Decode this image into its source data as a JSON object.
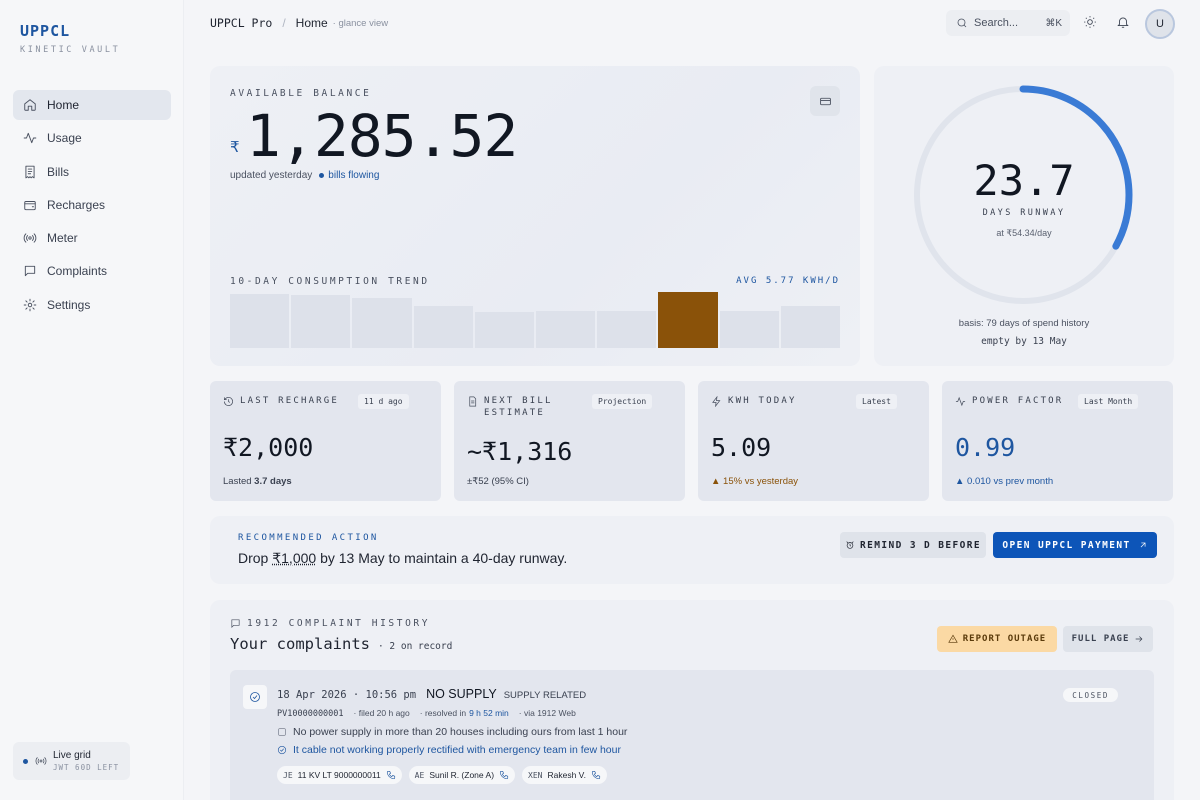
{
  "brand": {
    "name": "UPPCL",
    "tagline": "KINETIC VAULT"
  },
  "sidebar": {
    "items": [
      {
        "label": "Home",
        "icon": "home-icon",
        "active": true
      },
      {
        "label": "Usage",
        "icon": "activity-icon"
      },
      {
        "label": "Bills",
        "icon": "receipt-icon"
      },
      {
        "label": "Recharges",
        "icon": "wallet-icon"
      },
      {
        "label": "Meter",
        "icon": "meter-icon"
      },
      {
        "label": "Complaints",
        "icon": "message-icon"
      },
      {
        "label": "Settings",
        "icon": "gear-icon"
      }
    ],
    "live": {
      "title": "Live grid",
      "sub": "JWT 60D LEFT"
    }
  },
  "header": {
    "app": "UPPCL Pro",
    "page": "Home",
    "hint": "· glance view",
    "search_placeholder": "Search...",
    "shortcut": "⌘K",
    "avatar": "U"
  },
  "balance": {
    "label": "AVAILABLE BALANCE",
    "currency": "₹",
    "value": "1,285.52",
    "updated": "updated yesterday",
    "status": "bills flowing",
    "trend_label": "10-DAY CONSUMPTION TREND",
    "trend_avg": "AVG 5.77 KWH/D"
  },
  "chart_data": {
    "type": "bar",
    "title": "10-DAY CONSUMPTION TREND",
    "values": [
      5.4,
      5.3,
      5.0,
      4.2,
      3.6,
      3.7,
      3.7,
      5.6,
      3.7,
      4.2
    ],
    "highlight_index": 7,
    "unit": "kWh/d",
    "average": 5.77,
    "colors": {
      "bar": "#dde1ea",
      "highlight": "#8a5209"
    }
  },
  "runway": {
    "value": "23.7",
    "label": "DAYS RUNWAY",
    "rate": "at ₹54.34/day",
    "basis": "basis: 79 days of spend history",
    "empty": "empty by 13 May",
    "progress": 0.33,
    "accent": "#3a7bd5"
  },
  "stats": [
    {
      "title": "LAST RECHARGE",
      "icon": "history-icon",
      "badge": "11 d ago",
      "value": "₹2,000",
      "foot_pre": "Lasted ",
      "foot_bold": "3.7 days",
      "foot_post": ""
    },
    {
      "title": "NEXT BILL ESTIMATE",
      "icon": "document-icon",
      "badge": "Projection",
      "value": "~₹1,316",
      "foot_pre": "±₹52 (95% CI)",
      "foot_bold": "",
      "foot_post": ""
    },
    {
      "title": "KWH TODAY",
      "icon": "bolt-icon",
      "badge": "Latest",
      "value": "5.09",
      "foot_pre": "▲ 15% vs yesterday",
      "foot_bold": "",
      "foot_post": ""
    },
    {
      "title": "POWER FACTOR",
      "icon": "pulse-icon",
      "badge": "Last Month",
      "value": "0.99",
      "foot_pre": "▲ 0.010 vs prev month",
      "foot_bold": "",
      "foot_post": ""
    }
  ],
  "recommendation": {
    "label": "RECOMMENDED ACTION",
    "text_pre": "Drop ",
    "amount": "₹1,000",
    "text_post": " by 13 May to maintain a 40-day runway.",
    "remind_label": "REMIND 3 D BEFORE",
    "pay_label": "OPEN UPPCL PAYMENT"
  },
  "complaints": {
    "section_label": "1912 COMPLAINT HISTORY",
    "title": "Your complaints",
    "count": "· 2 on record",
    "report_label": "REPORT OUTAGE",
    "full_label": "FULL PAGE",
    "ticket": {
      "date": "18 Apr 2026 · 10:56 pm",
      "type": "NO SUPPLY",
      "category": "SUPPLY RELATED",
      "status": "CLOSED",
      "id": "PV10000000001",
      "filed": "· filed 20 h ago",
      "resolved_pre": "· resolved in",
      "resolved": "9 h 52 min",
      "via": "· via 1912 Web",
      "description": "No power supply in more than 20 houses including ours from last 1 hour",
      "resolution": "It cable not working properly rectified with emergency team in few hour",
      "contacts": [
        {
          "role": "JE",
          "name": "11 KV LT 9000000011"
        },
        {
          "role": "AE",
          "name": "Sunil R. (Zone A)"
        },
        {
          "role": "XEN",
          "name": "Rakesh V."
        }
      ]
    }
  }
}
